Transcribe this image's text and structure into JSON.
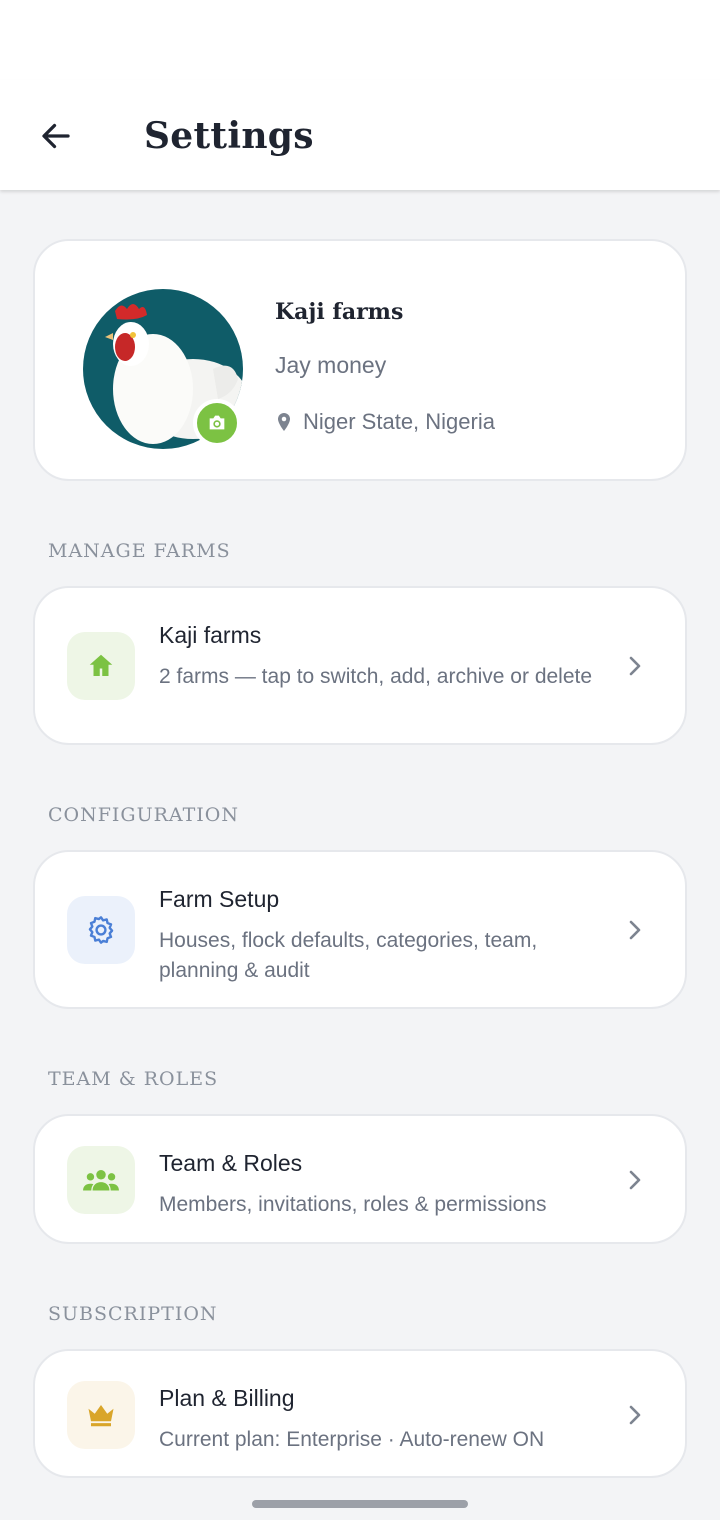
{
  "header": {
    "title": "Settings"
  },
  "profile": {
    "farm_name": "Kaji farms",
    "owner_name": "Jay money",
    "location": "Niger State, Nigeria"
  },
  "sections": {
    "manage_farms": {
      "label": "MANAGE FARMS",
      "item": {
        "title": "Kaji farms",
        "subtitle": "2 farms — tap to switch, add, archive or delete",
        "icon": "home-icon"
      }
    },
    "configuration": {
      "label": "CONFIGURATION",
      "item": {
        "title": "Farm Setup",
        "subtitle": "Houses, flock defaults, categories, team, planning & audit",
        "icon": "gear-icon"
      }
    },
    "team_roles": {
      "label": "TEAM & ROLES",
      "item": {
        "title": "Team & Roles",
        "subtitle": "Members, invitations, roles & permissions",
        "icon": "people-icon"
      }
    },
    "subscription": {
      "label": "SUBSCRIPTION",
      "item": {
        "title": "Plan & Billing",
        "subtitle": "Current plan: Enterprise · Auto-renew ON",
        "icon": "crown-icon"
      }
    }
  },
  "colors": {
    "accent_green": "#7cc243",
    "icon_blue": "#4a7fd6",
    "icon_gold": "#d9a52a",
    "background": "#f3f4f6"
  }
}
